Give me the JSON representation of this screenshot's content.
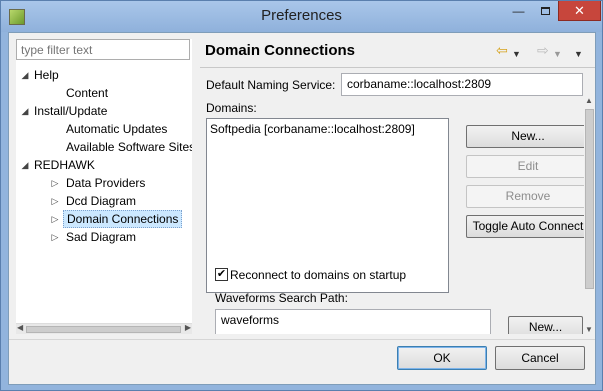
{
  "window": {
    "title": "Preferences",
    "minimize_label": "—",
    "close_label": "✕"
  },
  "tree": {
    "filter_placeholder": "type filter text",
    "items": [
      {
        "label": "Help",
        "arrow": "◢"
      },
      {
        "label": "Content",
        "arrow": ""
      },
      {
        "label": "Install/Update",
        "arrow": "◢"
      },
      {
        "label": "Automatic Updates",
        "arrow": ""
      },
      {
        "label": "Available Software Sites",
        "arrow": ""
      },
      {
        "label": "REDHAWK",
        "arrow": "◢"
      },
      {
        "label": "Data Providers",
        "arrow": "▷"
      },
      {
        "label": "Dcd Diagram",
        "arrow": "▷"
      },
      {
        "label": "Domain Connections",
        "arrow": "▷",
        "selected": true
      },
      {
        "label": "Sad Diagram",
        "arrow": "▷"
      }
    ]
  },
  "page": {
    "title": "Domain Connections",
    "nav": {
      "back_icon": "⇦",
      "forward_icon": "⇨",
      "dropdown_icon": "▼"
    },
    "naming_service_label": "Default Naming Service:",
    "naming_service_value": "corbaname::localhost:2809",
    "domains_label": "Domains:",
    "domains": [
      "Softpedia [corbaname::localhost:2809]"
    ],
    "buttons": {
      "new": "New...",
      "edit": "Edit",
      "remove": "Remove",
      "toggle": "Toggle Auto Connect",
      "waveforms_new": "New..."
    },
    "reconnect_label": "Reconnect to domains on startup",
    "reconnect_checked": true,
    "checkmark": "✔",
    "waveforms_label": "Waveforms Search Path:",
    "waveforms_paths": [
      "waveforms"
    ]
  },
  "dialog": {
    "ok": "OK",
    "cancel": "Cancel"
  },
  "colors": {
    "frame": "#92b4dd",
    "close_button": "#c7463c",
    "selection": "#cce8ff"
  }
}
